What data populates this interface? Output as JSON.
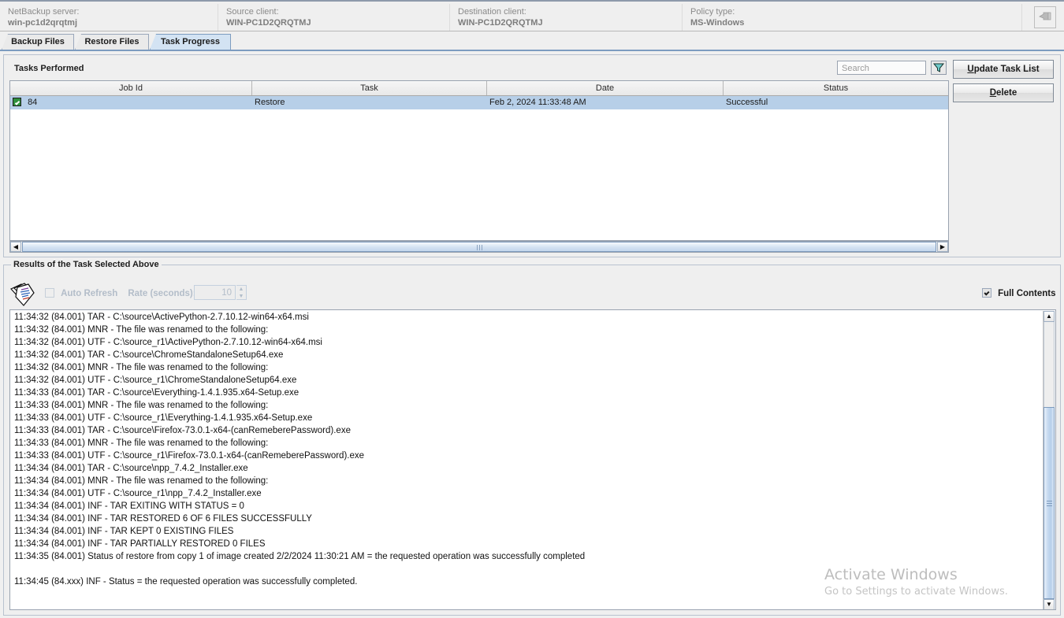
{
  "topbar": {
    "fields": [
      {
        "label": "NetBackup server:",
        "value": "win-pc1d2qrqtmj"
      },
      {
        "label": "Source client:",
        "value": "WIN-PC1D2QRQTMJ"
      },
      {
        "label": "Destination client:",
        "value": "WIN-PC1D2QRQTMJ"
      },
      {
        "label": "Policy type:",
        "value": "MS-Windows"
      }
    ],
    "help_button_icon": "pointer-hand-icon"
  },
  "tabs": [
    {
      "label": "Backup Files",
      "active": false
    },
    {
      "label": "Restore Files",
      "active": false
    },
    {
      "label": "Task Progress",
      "active": true
    }
  ],
  "tasks_panel": {
    "title": "Tasks Performed",
    "search": {
      "value": "",
      "placeholder": "Search"
    },
    "filter_icon": "funnel-filter-icon",
    "buttons": [
      {
        "label_pre": "U",
        "label_post": "pdate Task List",
        "name": "update-task-list-button"
      },
      {
        "label_pre": "D",
        "label_post": "elete",
        "name": "delete-button"
      }
    ],
    "columns": [
      "Job Id",
      "Task",
      "Date",
      "Status"
    ],
    "rows": [
      {
        "checked": true,
        "job_id": "84",
        "task": "Restore",
        "date": "Feb 2, 2024 11:33:48 AM",
        "status": "Successful"
      }
    ]
  },
  "results_panel": {
    "title": "Results of the Task Selected Above",
    "doc_icon": "documents-icon",
    "auto_refresh": {
      "label": "Auto Refresh",
      "checked": false,
      "enabled": false
    },
    "rate": {
      "label": "Rate (seconds):",
      "value": "10",
      "enabled": false
    },
    "full_contents": {
      "label": "Full Contents",
      "checked": true
    },
    "log": "11:34:32 (84.001) TAR - C:\\source\\ActivePython-2.7.10.12-win64-x64.msi\n11:34:32 (84.001) MNR - The file was renamed to the following:\n11:34:32 (84.001) UTF - C:\\source_r1\\ActivePython-2.7.10.12-win64-x64.msi\n11:34:32 (84.001) TAR - C:\\source\\ChromeStandaloneSetup64.exe\n11:34:32 (84.001) MNR - The file was renamed to the following:\n11:34:32 (84.001) UTF - C:\\source_r1\\ChromeStandaloneSetup64.exe\n11:34:33 (84.001) TAR - C:\\source\\Everything-1.4.1.935.x64-Setup.exe\n11:34:33 (84.001) MNR - The file was renamed to the following:\n11:34:33 (84.001) UTF - C:\\source_r1\\Everything-1.4.1.935.x64-Setup.exe\n11:34:33 (84.001) TAR - C:\\source\\Firefox-73.0.1-x64-(canRemeberePassword).exe\n11:34:33 (84.001) MNR - The file was renamed to the following:\n11:34:33 (84.001) UTF - C:\\source_r1\\Firefox-73.0.1-x64-(canRemeberePassword).exe\n11:34:34 (84.001) TAR - C:\\source\\npp_7.4.2_Installer.exe\n11:34:34 (84.001) MNR - The file was renamed to the following:\n11:34:34 (84.001) UTF - C:\\source_r1\\npp_7.4.2_Installer.exe\n11:34:34 (84.001) INF - TAR EXITING WITH STATUS = 0\n11:34:34 (84.001) INF - TAR RESTORED 6 OF 6 FILES SUCCESSFULLY\n11:34:34 (84.001) INF - TAR KEPT 0 EXISTING FILES\n11:34:34 (84.001) INF - TAR PARTIALLY RESTORED 0 FILES\n11:34:35 (84.001) Status of restore from copy 1 of image created 2/2/2024 11:30:21 AM = the requested operation was successfully completed\n\n11:34:45 (84.xxx) INF - Status = the requested operation was successfully completed."
  },
  "watermark": {
    "title": "Activate Windows",
    "subtitle": "Go to Settings to activate Windows."
  },
  "colors": {
    "selection": "#b7cfe8",
    "active_tab": "#d3e3f3",
    "panel_bg": "#efefef",
    "accent_border": "#7d9cc0"
  }
}
